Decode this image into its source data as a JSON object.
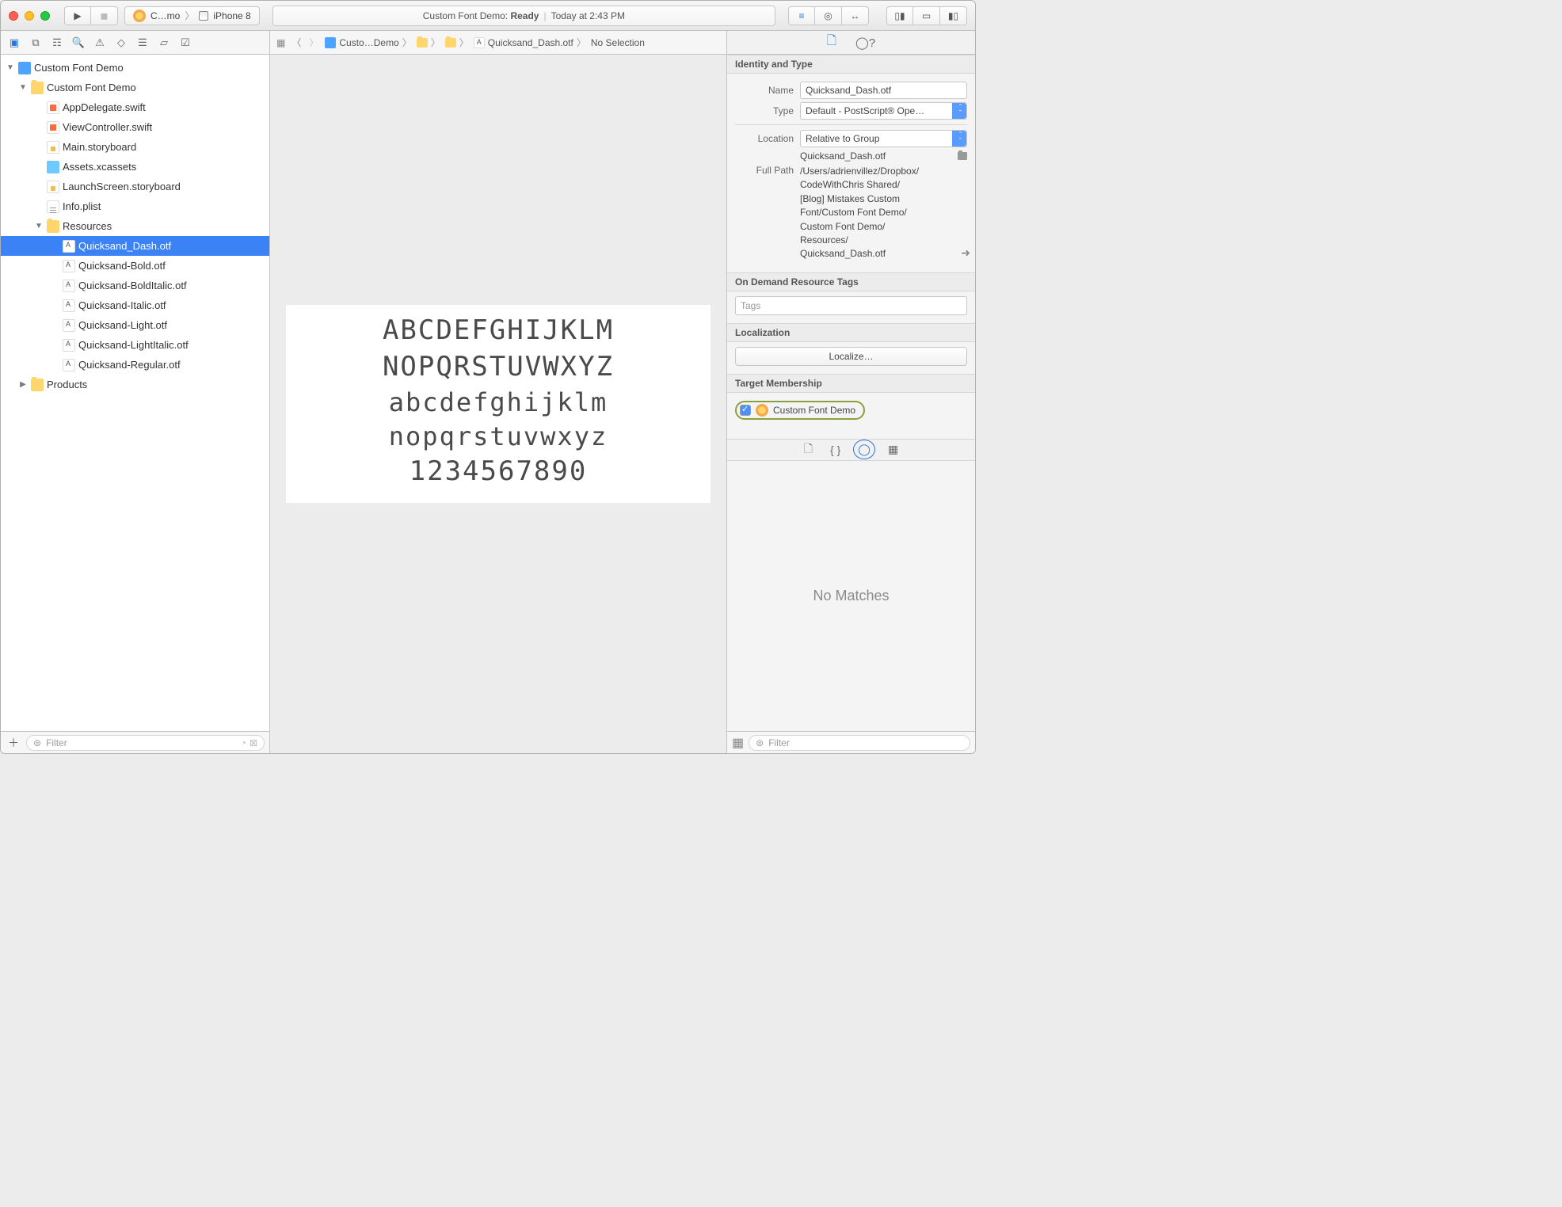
{
  "titlebar": {
    "scheme": {
      "project": "C…mo",
      "device": "iPhone 8"
    },
    "status_prefix": "Custom Font Demo: ",
    "status_state": "Ready",
    "status_time": "Today at 2:43 PM"
  },
  "jumpbar": {
    "items": [
      "Custo…Demo",
      "",
      "",
      "Quicksand_Dash.otf",
      "No Selection"
    ]
  },
  "navigator": {
    "project": "Custom Font Demo",
    "group": "Custom Font Demo",
    "files": [
      {
        "label": "AppDelegate.swift",
        "icon": "swift"
      },
      {
        "label": "ViewController.swift",
        "icon": "swift"
      },
      {
        "label": "Main.storyboard",
        "icon": "storyboard"
      },
      {
        "label": "Assets.xcassets",
        "icon": "assets"
      },
      {
        "label": "LaunchScreen.storyboard",
        "icon": "storyboard"
      },
      {
        "label": "Info.plist",
        "icon": "plist"
      }
    ],
    "resources_label": "Resources",
    "resources": [
      {
        "label": "Quicksand_Dash.otf",
        "selected": true
      },
      {
        "label": "Quicksand-Bold.otf"
      },
      {
        "label": "Quicksand-BoldItalic.otf"
      },
      {
        "label": "Quicksand-Italic.otf"
      },
      {
        "label": "Quicksand-Light.otf"
      },
      {
        "label": "Quicksand-LightItalic.otf"
      },
      {
        "label": "Quicksand-Regular.otf"
      }
    ],
    "products_label": "Products",
    "filter_placeholder": "Filter"
  },
  "preview": {
    "line1": "ABCDEFGHIJKLM",
    "line2": "NOPQRSTUVWXYZ",
    "line3": "abcdefghijklm",
    "line4": "nopqrstuvwxyz",
    "line5": "1234567890"
  },
  "inspector": {
    "identity_hdr": "Identity and Type",
    "name_label": "Name",
    "name_value": "Quicksand_Dash.otf",
    "type_label": "Type",
    "type_value": "Default - PostScript® Ope…",
    "location_label": "Location",
    "location_value": "Relative to Group",
    "location_file": "Quicksand_Dash.otf",
    "fullpath_label": "Full Path",
    "fullpath_lines": [
      "/Users/adrienvillez/Dropbox/",
      "CodeWithChris Shared/",
      "[Blog] Mistakes Custom",
      "Font/Custom Font Demo/",
      "Custom Font Demo/",
      "Resources/",
      "Quicksand_Dash.otf"
    ],
    "odr_hdr": "On Demand Resource Tags",
    "tags_placeholder": "Tags",
    "loc_hdr": "Localization",
    "loc_button": "Localize…",
    "target_hdr": "Target Membership",
    "target_name": "Custom Font Demo",
    "no_matches": "No Matches",
    "lib_filter_placeholder": "Filter"
  }
}
